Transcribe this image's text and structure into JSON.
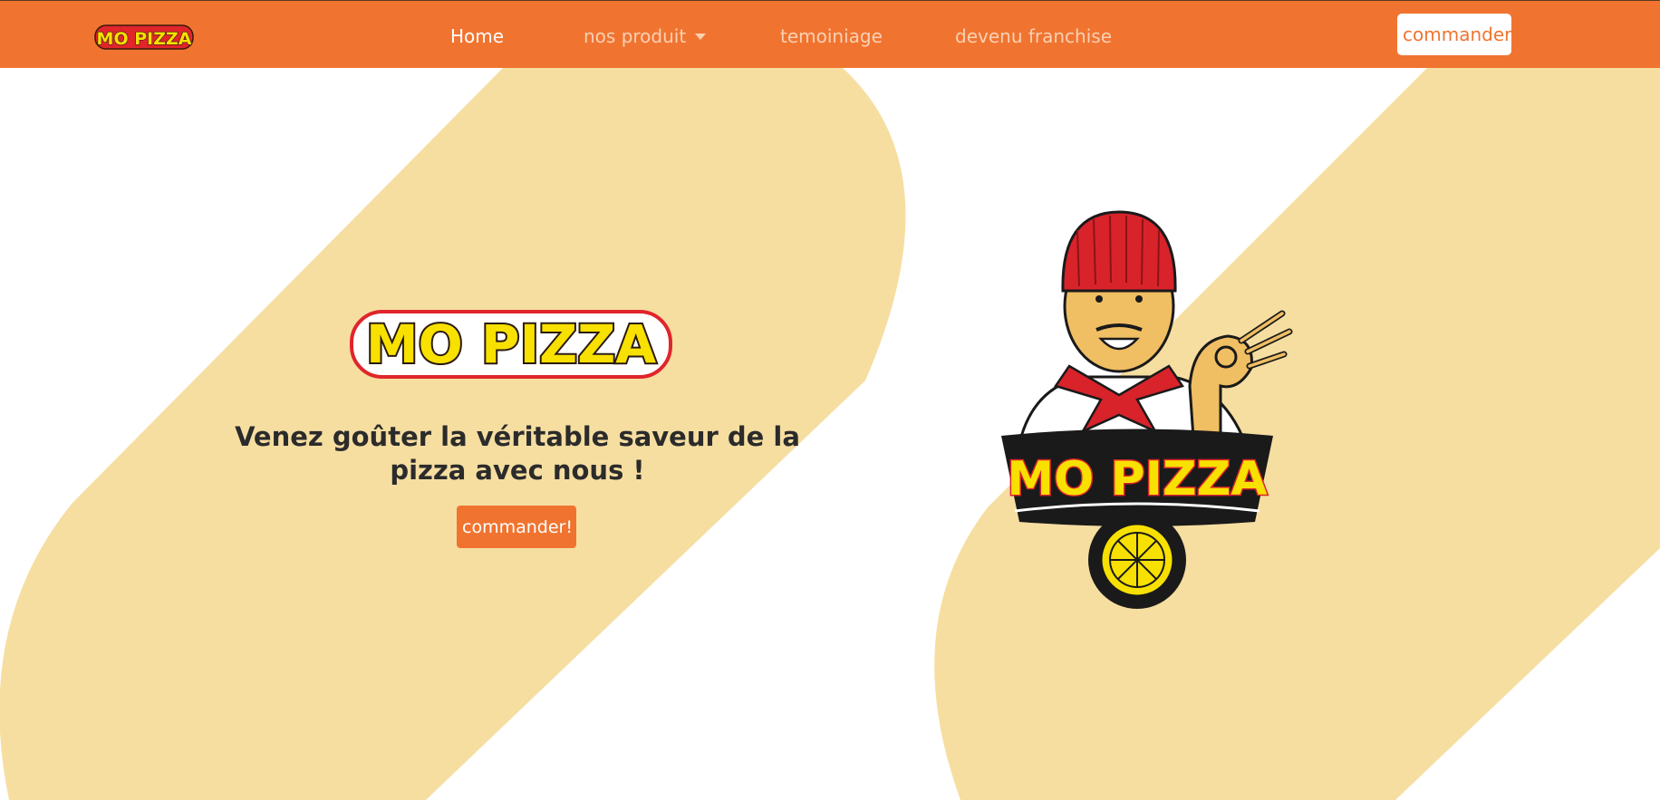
{
  "nav": {
    "brand_logo_text": "MO PIZZA",
    "links": [
      {
        "label": "Home",
        "active": true
      },
      {
        "label": "nos produit",
        "dropdown": true
      },
      {
        "label": "temoiniage"
      },
      {
        "label": "devenu franchise"
      }
    ],
    "cta_label": "commander"
  },
  "hero": {
    "logo_text": "MO PIZZA",
    "tagline": "Venez goûter la véritable saveur de la pizza avec nous !",
    "cta_label": "commander!"
  },
  "mascot": {
    "logo_text": "MO PIZZA"
  },
  "colors": {
    "primary": "#f07430",
    "band": "#f6dea1",
    "logo_yellow": "#f8e000",
    "logo_red": "#e0252b",
    "text_dark": "#2b2b2b",
    "background": "#ffffff"
  },
  "icons": {
    "dropdown": "caret-down-icon",
    "pizza": "pizza-icon"
  }
}
